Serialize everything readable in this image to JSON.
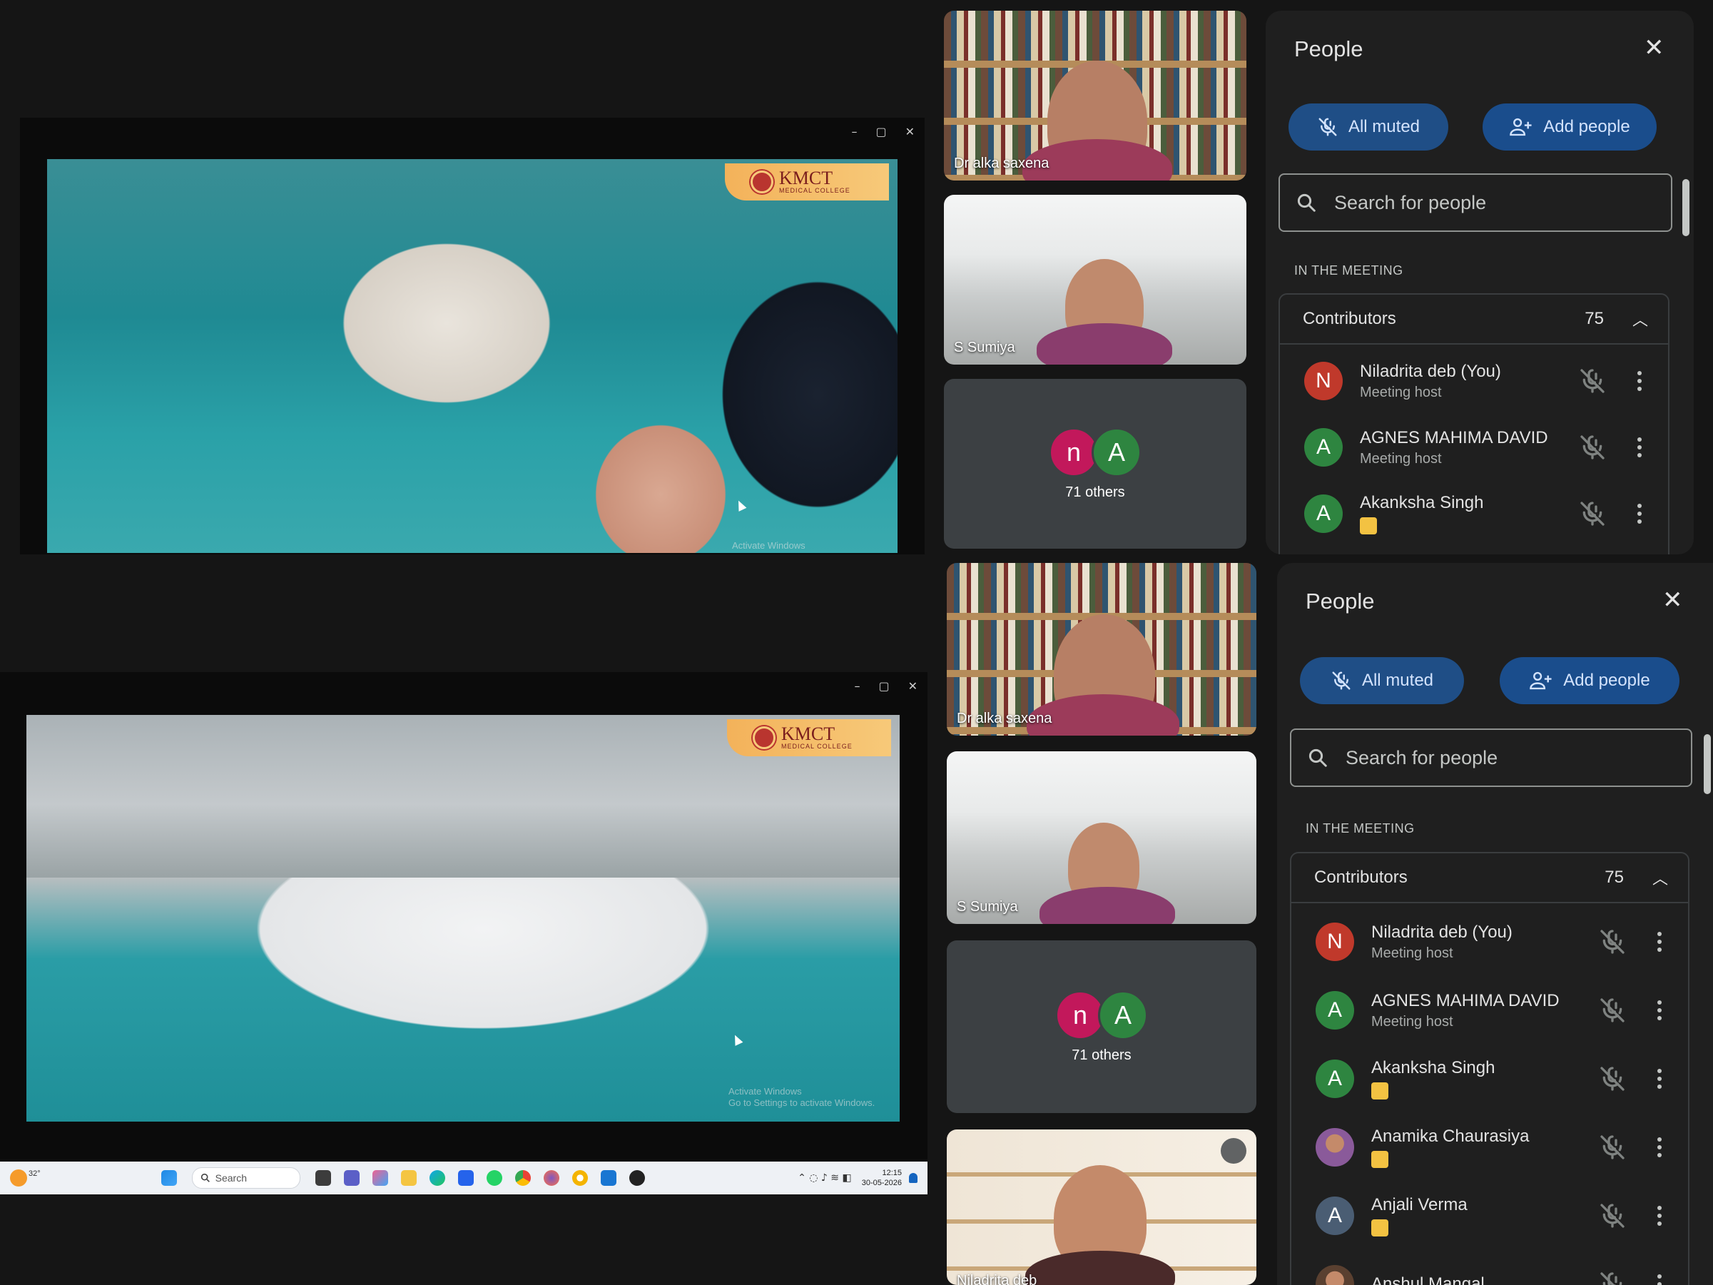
{
  "colors": {
    "accent": "#1f4e86",
    "avatar_red": "#c0392b",
    "avatar_green": "#2e8540",
    "avatar_pink": "#c2185b",
    "avatar_slate": "#4a5d73",
    "badge_yellow": "#f3c242"
  },
  "window_top": {
    "controls": [
      "–",
      "▢",
      "✕"
    ],
    "logo_text": "KMCT",
    "logo_sub": "MEDICAL COLLEGE",
    "watermark": "Activate Windows"
  },
  "window_bottom": {
    "controls": [
      "–",
      "▢",
      "✕"
    ],
    "logo_text": "KMCT",
    "logo_sub": "MEDICAL COLLEGE",
    "watermark_title": "Activate Windows",
    "watermark_sub": "Go to Settings to activate Windows."
  },
  "taskbar": {
    "weather": "32°",
    "search": "Search",
    "time": "12:15",
    "date": "30-05-2026"
  },
  "tiles_top": [
    {
      "name": "Dr alka saxena"
    },
    {
      "name": "S Sumiya"
    }
  ],
  "tiles_bottom": [
    {
      "name": "Dr alka saxena"
    },
    {
      "name": "S Sumiya"
    },
    {
      "name": "Niladrita deb"
    }
  ],
  "others": {
    "avatars": [
      "n",
      "A"
    ],
    "label": "71 others"
  },
  "people_panel": {
    "title": "People",
    "all_muted": "All muted",
    "add_people": "Add people",
    "search_placeholder": "Search for people",
    "section": "IN THE MEETING",
    "group_label": "Contributors",
    "group_count": "75",
    "participants": [
      {
        "initial": "N",
        "name": "Niladrita deb (You)",
        "sub": "Meeting host",
        "avatar_color": "#c0392b"
      },
      {
        "initial": "A",
        "name": "AGNES MAHIMA DAVID",
        "sub": "Meeting host",
        "avatar_color": "#2e8540"
      },
      {
        "initial": "A",
        "name": "Akanksha Singh",
        "sub": "",
        "avatar_color": "#2e8540"
      },
      {
        "initial": "",
        "name": "Anamika Chaurasiya",
        "sub": "",
        "avatar_color": "#8a6a5a"
      },
      {
        "initial": "A",
        "name": "Anjali Verma",
        "sub": "",
        "avatar_color": "#4a5d73"
      },
      {
        "initial": "",
        "name": "Anshul Mangal",
        "sub": "",
        "avatar_color": "#7a5a48"
      }
    ]
  }
}
